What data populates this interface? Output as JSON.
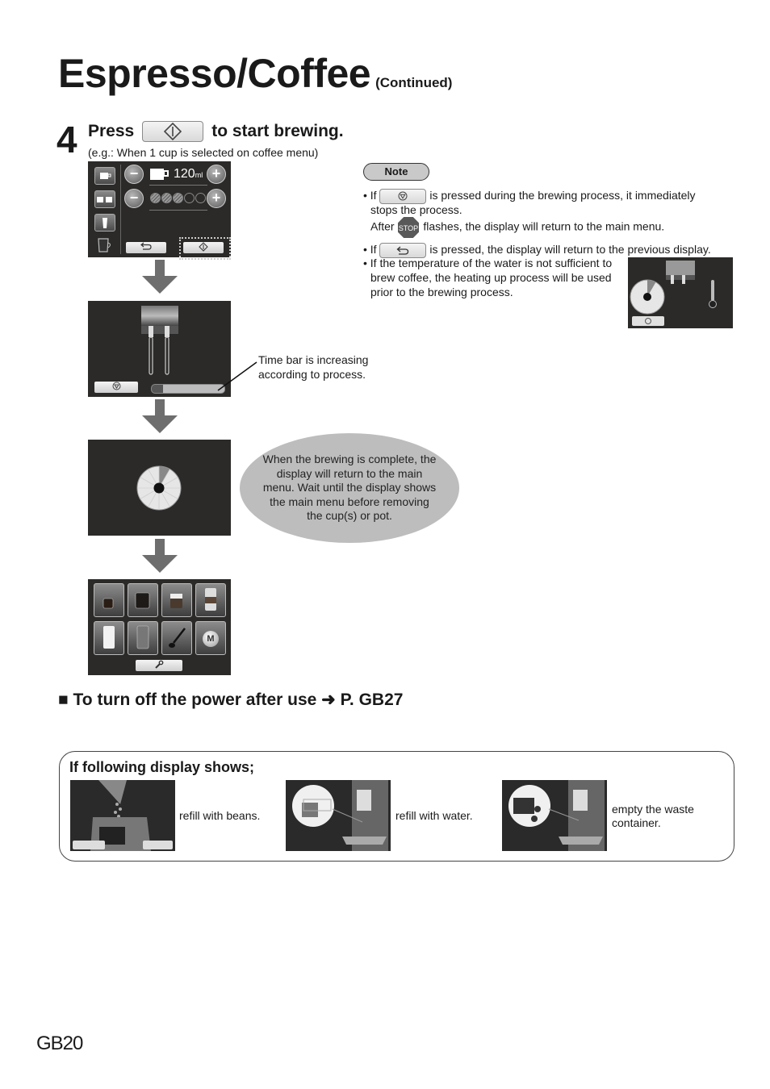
{
  "header": {
    "title": "Espresso/Coffee",
    "subtitle": "(Continued)"
  },
  "step": {
    "number": "4",
    "text_before": "Press",
    "button_icon": "start-icon",
    "text_after": "to start brewing.",
    "example": "(e.g.: When 1 cup is selected on coffee menu)"
  },
  "screen1": {
    "volume": "120",
    "volume_unit": "ml",
    "strength_level": 3,
    "strength_max": 5,
    "minus": "−",
    "plus": "+",
    "back_icon": "⮌",
    "start_icon": "◇"
  },
  "screen2": {
    "time_bar_progress": 0.15,
    "callout": [
      "Time bar is increasing",
      "according to process."
    ]
  },
  "screen3": {
    "bubble": "When the brewing is complete, the display will return to the main menu. Wait until the display shows the main menu before removing the cup(s) or pot."
  },
  "screen4": {
    "tiles": [
      "espresso",
      "coffee",
      "cappuccino",
      "latte-macchiato",
      "milk",
      "hot-water",
      "spoon",
      "memory"
    ],
    "memory_label": "M",
    "settings_icon": "wrench-icon"
  },
  "note": {
    "label": "Note",
    "items": [
      {
        "prefix": "• If",
        "icon": "stop-icon",
        "text": "is pressed during the brewing process, it immediately",
        "cont": "stops the process."
      },
      {
        "prefix": "After",
        "icon": "stop-sign",
        "stop_text": "STOP",
        "text": "flashes, the display will return to the main menu."
      },
      {
        "prefix": "• If",
        "icon": "back-icon",
        "text": "is pressed, the display will return to the previous display."
      },
      {
        "lines": [
          "• If the temperature of the water is not sufficient to",
          "brew coffee, the heating up process will be used",
          "prior to the brewing process."
        ]
      }
    ]
  },
  "power": {
    "bullet": "■",
    "text": "To turn off the power after use",
    "arrow": "➜",
    "ref": "P. GB27"
  },
  "display_box": {
    "title": "If following display shows;",
    "items": [
      {
        "image": "beans-refill",
        "caption": "refill with beans."
      },
      {
        "image": "water-refill",
        "caption": "refill with water."
      },
      {
        "image": "waste-container",
        "caption": "empty the waste container."
      }
    ]
  },
  "footer": {
    "page": "GB20"
  }
}
